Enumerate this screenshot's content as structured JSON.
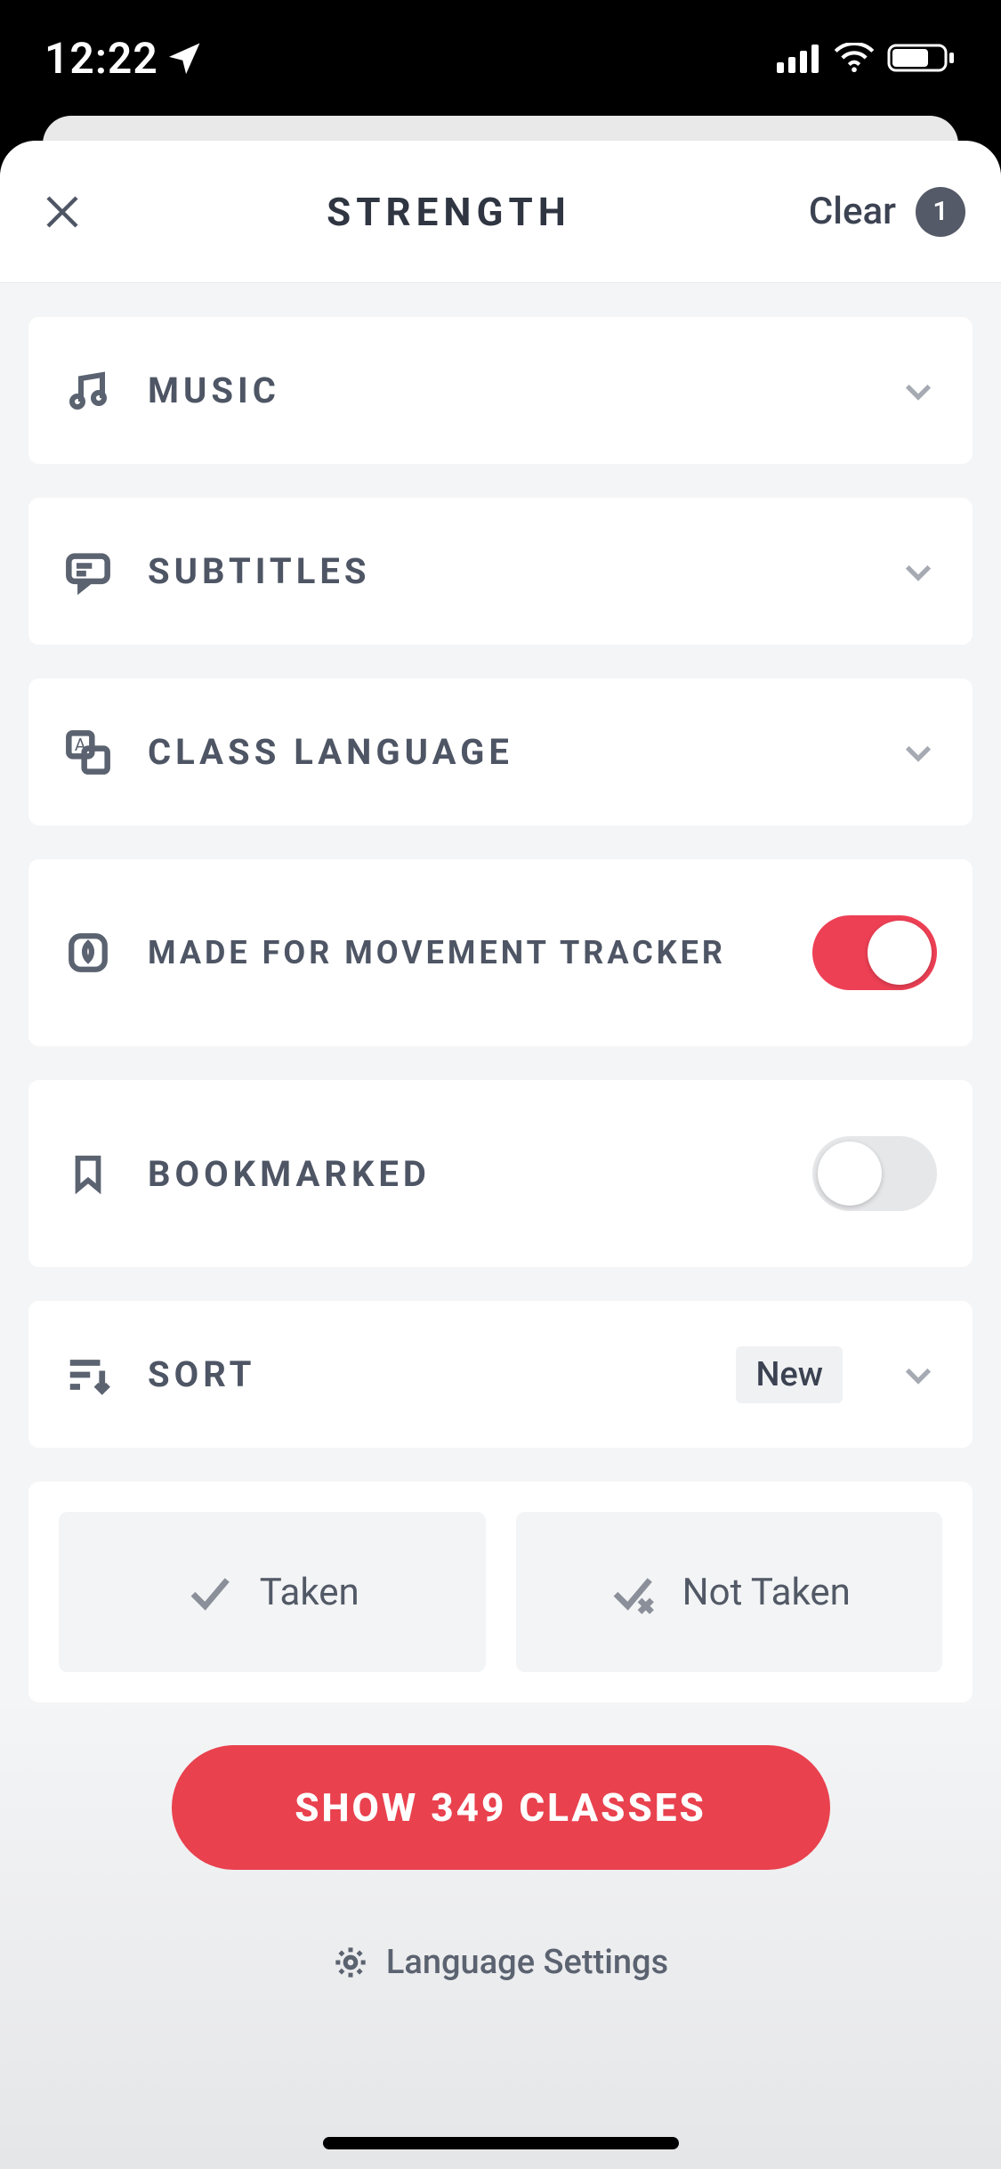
{
  "status_bar": {
    "time": "12:22"
  },
  "header": {
    "title": "STRENGTH",
    "clear_label": "Clear",
    "filter_count": "1"
  },
  "filters": {
    "music": {
      "label": "MUSIC"
    },
    "subtitles": {
      "label": "SUBTITLES"
    },
    "class_language": {
      "label": "CLASS LANGUAGE"
    },
    "movement_tracker": {
      "label": "MADE FOR MOVEMENT TRACKER",
      "enabled": true
    },
    "bookmarked": {
      "label": "BOOKMARKED",
      "enabled": false
    },
    "sort": {
      "label": "SORT",
      "value": "New"
    },
    "taken": {
      "taken_label": "Taken",
      "not_taken_label": "Not Taken"
    }
  },
  "footer": {
    "show_button_label": "SHOW 349 CLASSES",
    "language_settings_label": "Language Settings"
  }
}
